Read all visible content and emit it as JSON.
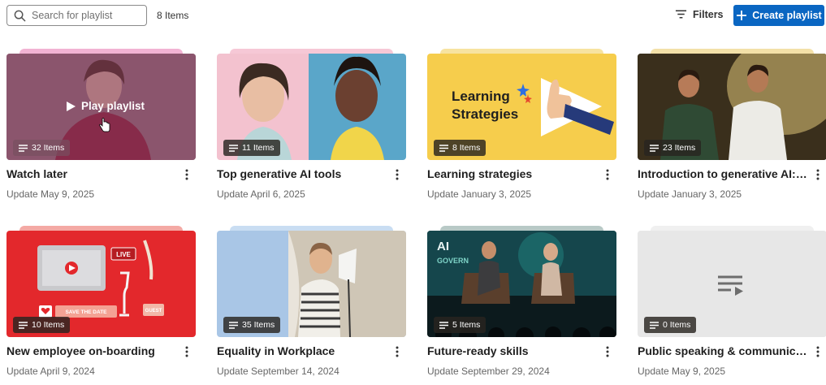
{
  "toolbar": {
    "search_placeholder": "Search for playlist",
    "item_count": "8 Items",
    "filters_label": "Filters",
    "create_label": "Create playlist",
    "accent_color": "#0a66c2"
  },
  "playlists": [
    {
      "title": "Watch later",
      "updated": "Update May 9, 2025",
      "items": "32 Items",
      "hover_label": "Play playlist"
    },
    {
      "title": "Top generative AI tools",
      "updated": "Update April 6, 2025",
      "items": "11 Items"
    },
    {
      "title": "Learning strategies",
      "updated": "Update January 3, 2025",
      "items": "8 Items",
      "thumb_text_1": "Learning",
      "thumb_text_2": "Strategies"
    },
    {
      "title": "Introduction to generative AI: U...",
      "updated": "Update January 3, 2025",
      "items": "23 Items"
    },
    {
      "title": "New employee on-boarding",
      "updated": "Update April 9, 2024",
      "items": "10 Items",
      "thumb_live": "LIVE",
      "thumb_save": "SAVE THE DATE",
      "thumb_guest": "GUEST"
    },
    {
      "title": "Equality in Workplace",
      "updated": "Update September 14, 2024",
      "items": "35 Items"
    },
    {
      "title": "Future-ready skills",
      "updated": "Update September 29, 2024",
      "items": "5 Items",
      "thumb_ai": "AI",
      "thumb_govern": "GOVERN"
    },
    {
      "title": "Public speaking & communicatio...",
      "updated": "Update May 9, 2025",
      "items": "0 Items"
    }
  ]
}
